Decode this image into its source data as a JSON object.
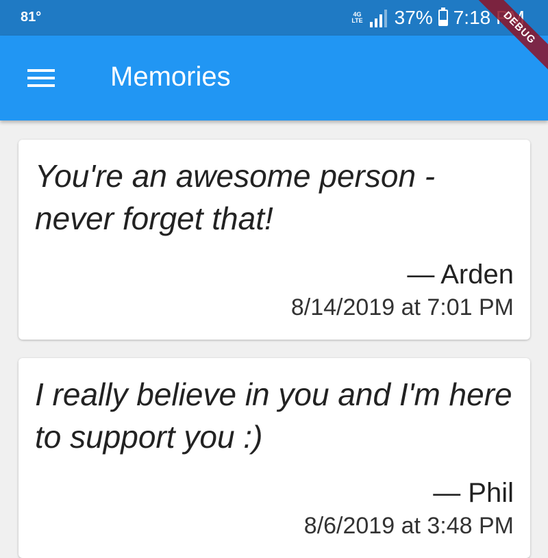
{
  "status_bar": {
    "temperature": "81°",
    "network_label_top": "4G",
    "network_label_bottom": "LTE",
    "battery_percent": "37%",
    "battery_level": 0.37,
    "time": "7:18 PM",
    "color": "#1f7ac4"
  },
  "debug_banner": {
    "label": "DEBUG"
  },
  "app_bar": {
    "title": "Memories",
    "menu_icon": "hamburger-menu-icon",
    "color": "#2196f3"
  },
  "memories": [
    {
      "quote": "You're an awesome person - never forget that!",
      "author": "— Arden",
      "timestamp": "8/14/2019 at 7:01 PM"
    },
    {
      "quote": "I really believe in you and I'm here to support you :)",
      "author": "— Phil",
      "timestamp": "8/6/2019 at 3:48 PM"
    }
  ]
}
